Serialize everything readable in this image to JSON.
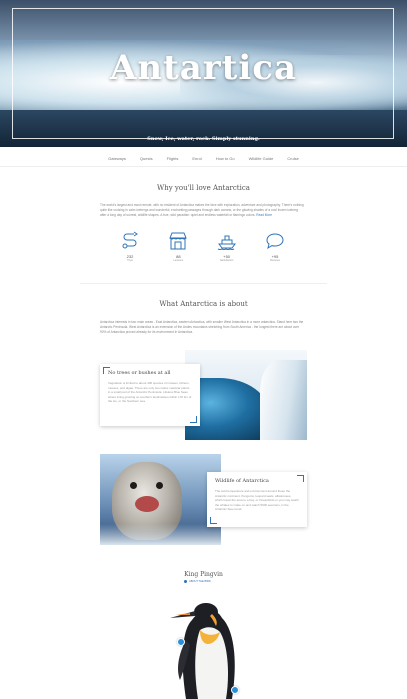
{
  "hero": {
    "title": "Antartica",
    "tagline": "Snow, Ice, water, rock. Simply stunning."
  },
  "nav": {
    "items": [
      "Gateways",
      "Quests",
      "Flights",
      "Enrol",
      "How to Go",
      "Wildlife Guide",
      "Cruise"
    ]
  },
  "why": {
    "title": "Why you'll love Antarctica",
    "paragraph": "The world's largest and most remote, with no resident of Antarctica makes the face with exploration, adventure and photography. There's nothing quite like cruising in calm icebergs and wonderful, enchanting passages through dark oceans, or the glowing shades of a cool frozen iceberg after a long day of surreal, wildlife shapes. A true, wild paradise: quiet and endless waterfall or flamingo colors.",
    "more_link": "Read More",
    "features": [
      {
        "icon": "route-icon",
        "value": "232",
        "label": "Trips"
      },
      {
        "icon": "store-icon",
        "value": "88",
        "label": "Lessons"
      },
      {
        "icon": "ship-icon",
        "value": "+50",
        "label": "Satisfaction"
      },
      {
        "icon": "chat-icon",
        "value": "+95",
        "label": "Reviews"
      }
    ]
  },
  "about": {
    "title": "What Antarctica is about",
    "paragraph": "Antarctica interests in two main areas - East Antarctica, eastern Antarctica, with smaller West Antarctica in a more antarctica. Stand here two the Antarctic Peninsula. West Antarctica is an extension of the Andes mountains stretching from South America - the longest there are about over 90% of Antarctica proved already for its environment in Antarctica."
  },
  "cards": [
    {
      "title": "No trees or bushes at all",
      "text": "Vegetation is limited to about 400 species of mosses, lichens, mosses, and algae. There are only two native vascular plants in a small part of the Antarctic Peninsula. Lifeless Blue Seas where living growing on southern landmasses within 170 km of the ice, or the Southern sea."
    },
    {
      "title": "Wildlife of Antarctica",
      "text": "The cold temperature and environment around these the Antarctic continent. Penguins, leopard seals, albatrosses, which travel the area to a bay, or Oceanbirds or you may watch the whales to make on and watch 5000 sea lions, in the Antarctic Sea round."
    }
  ],
  "king": {
    "title": "King Pingvin",
    "subtitle": "ABOUT THE BIRD"
  },
  "colors": {
    "accent": "#2e74b8",
    "hotspot": "#2a8fd6"
  }
}
